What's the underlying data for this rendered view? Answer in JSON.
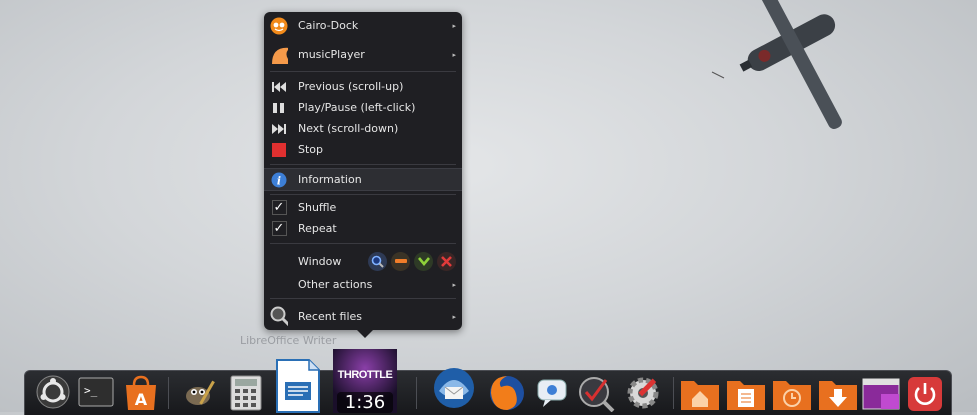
{
  "menu": {
    "items": [
      {
        "label": "Cairo-Dock",
        "icon": "cairo-dock-icon",
        "submenu": true
      },
      {
        "label": "musicPlayer",
        "icon": "music-player-icon",
        "submenu": true
      },
      {
        "label": "Previous (scroll-up)",
        "icon": "previous-icon"
      },
      {
        "label": "Play/Pause (left-click)",
        "icon": "pause-icon"
      },
      {
        "label": "Next (scroll-down)",
        "icon": "next-icon"
      },
      {
        "label": "Stop",
        "icon": "stop-icon"
      },
      {
        "label": "Information",
        "icon": "information-icon",
        "highlighted": true
      },
      {
        "label": "Shuffle",
        "checked": true
      },
      {
        "label": "Repeat",
        "checked": true
      },
      {
        "label": "Window"
      },
      {
        "label": "Other actions",
        "submenu": true
      },
      {
        "label": "Recent files",
        "icon": "recent-files-icon",
        "submenu": true
      }
    ],
    "window_buttons": [
      "magnify-icon",
      "minimize-icon",
      "maximize-icon",
      "close-icon"
    ]
  },
  "dock": {
    "hover_label": "LibreOffice Writer",
    "clock_time": "1:36",
    "album_title": "THROTTLE",
    "items": [
      "ubuntu-icon",
      "terminal-icon",
      "software-center-icon",
      "gimp-icon",
      "calculator-icon",
      "libreoffice-writer-icon",
      "music-player-icon",
      "thunderbird-icon",
      "firefox-icon",
      "messaging-icon",
      "system-monitor-icon",
      "settings-icon",
      "home-folder-icon",
      "documents-folder-icon",
      "recent-folder-icon",
      "downloads-folder-icon",
      "workspace-icon",
      "power-icon"
    ]
  },
  "colors": {
    "menu_bg": "#1f1f23",
    "dock_bg": "#1d1e21",
    "accent_orange": "#f07d2a",
    "stop_red": "#e03030",
    "info_blue": "#3d7fd6"
  }
}
